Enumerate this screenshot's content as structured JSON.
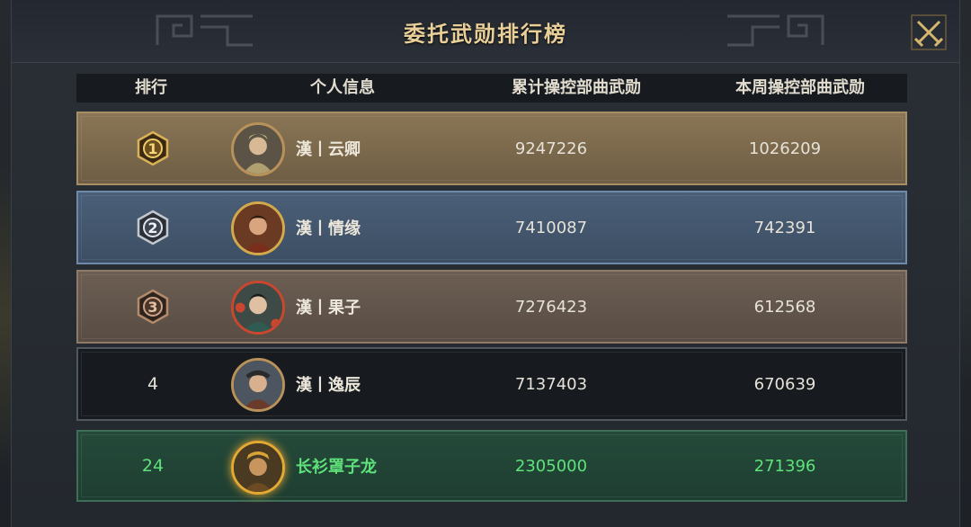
{
  "header": {
    "title": "委托武勋排行榜",
    "close_icon": "crossed-swords-close-icon"
  },
  "columns": {
    "rank": "排行",
    "info": "个人信息",
    "total": "累计操控部曲武勋",
    "weekly": "本周操控部曲武勋"
  },
  "rows": [
    {
      "rank": "1",
      "medal": "gold-medal-icon",
      "name": "漢丨云卿",
      "total": "9247226",
      "weekly": "1026209"
    },
    {
      "rank": "2",
      "medal": "silver-medal-icon",
      "name": "漢丨情缘",
      "total": "7410087",
      "weekly": "742391"
    },
    {
      "rank": "3",
      "medal": "bronze-medal-icon",
      "name": "漢丨果子",
      "total": "7276423",
      "weekly": "612568"
    },
    {
      "rank": "4",
      "name": "漢丨逸辰",
      "total": "7137403",
      "weekly": "670639"
    }
  ],
  "self_row": {
    "rank": "24",
    "name": "长衫罩子龙",
    "total": "2305000",
    "weekly": "271396"
  },
  "colors": {
    "title": "#e9cf98",
    "gold_row": "#8a7656",
    "silver_row": "#4a5f78",
    "bronze_row": "#6c5e53",
    "self_text": "#5fe27a"
  }
}
